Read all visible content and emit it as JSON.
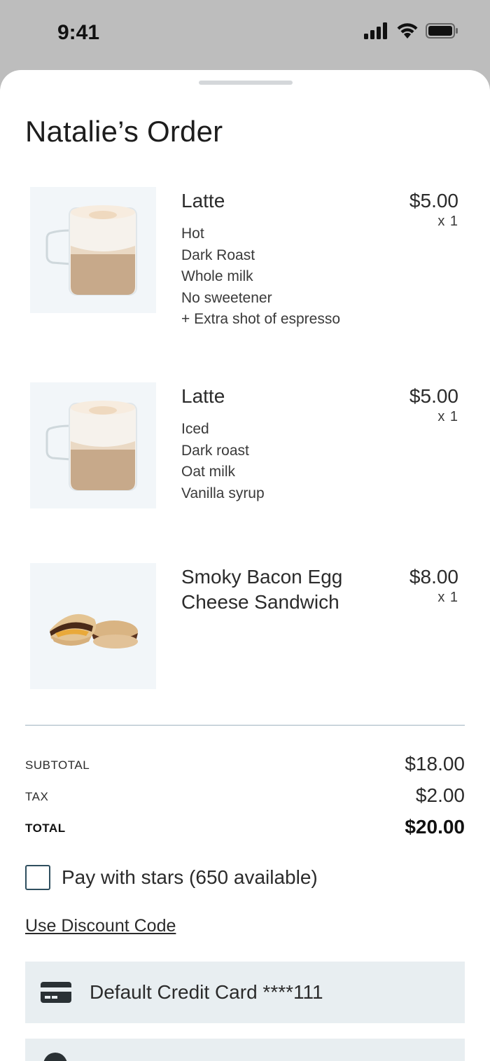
{
  "status_bar": {
    "time": "9:41"
  },
  "order": {
    "title": "Natalie’s Order",
    "items": [
      {
        "name": "Latte",
        "price": "$5.00",
        "qty": "x 1",
        "options": [
          "Hot",
          "Dark Roast",
          "Whole milk",
          "No sweetener",
          "+ Extra shot of espresso"
        ],
        "image": "latte-image"
      },
      {
        "name": "Latte",
        "price": "$5.00",
        "qty": "x 1",
        "options": [
          "Iced",
          "Dark roast",
          "Oat milk",
          "Vanilla syrup"
        ],
        "image": "latte-image"
      },
      {
        "name_line1": "Smoky Bacon Egg",
        "name_line2": "Cheese Sandwich",
        "price": "$8.00",
        "qty": "x 1",
        "image": "sandwich-image"
      }
    ]
  },
  "summary": {
    "subtotal_label": "SUBTOTAL",
    "subtotal": "$18.00",
    "tax_label": "TAX",
    "tax": "$2.00",
    "total_label": "TOTAL",
    "total": "$20.00"
  },
  "pay_with_stars": {
    "label": "Pay with stars (650 available)",
    "checked": false
  },
  "discount_link": "Use Discount Code",
  "payment_method": {
    "label": "Default Credit Card ****111",
    "icon": "credit-card-icon"
  },
  "colors": {
    "sheet_bg": "#ffffff",
    "status_bg": "#bdbdbd",
    "thumb_bg": "#f2f6f9",
    "card_bg": "#e8eef1",
    "divider": "#9fb3bf"
  }
}
